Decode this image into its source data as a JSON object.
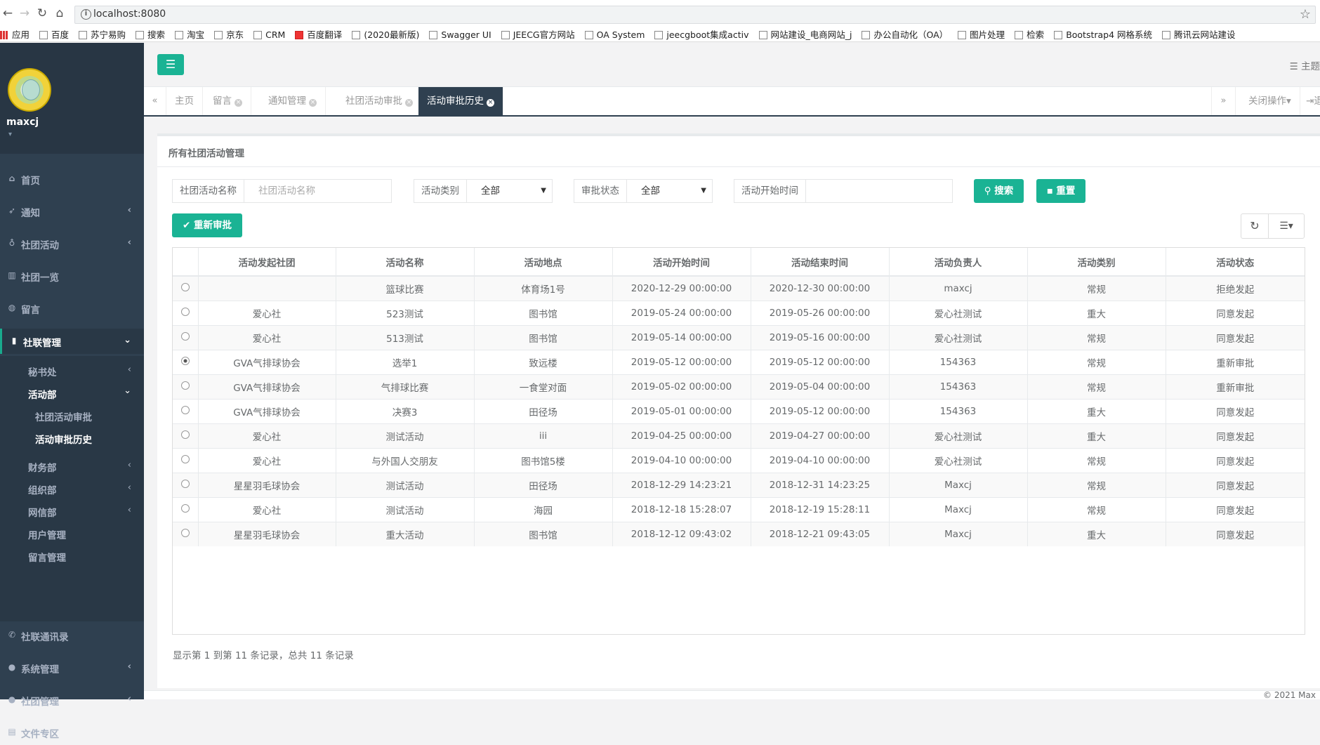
{
  "browser": {
    "url": "localhost:8080",
    "bookmarks": [
      "应用",
      "百度",
      "苏宁易购",
      "搜索",
      "淘宝",
      "京东",
      "CRM",
      "百度翻译",
      "(2020最新版)",
      "Swagger UI",
      "JEECG官方网站",
      "OA System",
      "jeecgboot集成activ",
      "网站建设_电商网站_j",
      "办公自动化（OA）",
      "图片处理",
      "检索",
      "Bootstrap4 网格系统",
      "腾讯云网站建设"
    ]
  },
  "sidebar": {
    "username": "maxcj",
    "menu": [
      {
        "label": "首页"
      },
      {
        "label": "通知"
      },
      {
        "label": "社团活动"
      },
      {
        "label": "社团一览"
      },
      {
        "label": "留言"
      },
      {
        "label": "社联管理"
      }
    ],
    "sub": [
      {
        "label": "秘书处"
      },
      {
        "label": "活动部"
      },
      {
        "label": "社团活动审批"
      },
      {
        "label": "活动审批历史"
      },
      {
        "label": "财务部"
      },
      {
        "label": "组织部"
      },
      {
        "label": "网信部"
      },
      {
        "label": "用户管理"
      },
      {
        "label": "留言管理"
      }
    ],
    "bottom": [
      {
        "label": "社联通讯录"
      },
      {
        "label": "系统管理"
      },
      {
        "label": "社团管理"
      },
      {
        "label": "文件专区"
      }
    ]
  },
  "header": {
    "theme_label": "主题"
  },
  "tabs": [
    "主页",
    "留言",
    "通知管理",
    "社团活动审批",
    "活动审批历史"
  ],
  "tab_tools": {
    "close_ops": "关闭操作",
    "logout": "退"
  },
  "panel": {
    "title": "所有社团活动管理",
    "filters": {
      "name_label": "社团活动名称",
      "name_placeholder": "社团活动名称",
      "type_label": "活动类别",
      "type_value": "全部",
      "status_label": "审批状态",
      "status_value": "全部",
      "start_label": "活动开始时间",
      "start_value": ""
    },
    "search_btn": "搜索",
    "reset_btn": "重置",
    "reapprove_btn": "重新审批",
    "columns": [
      "",
      "活动发起社团",
      "活动名称",
      "活动地点",
      "活动开始时间",
      "活动结束时间",
      "活动负责人",
      "活动类别",
      "活动状态"
    ],
    "rows": [
      {
        "club": "",
        "name": "篮球比赛",
        "place": "体育场1号",
        "start": "2020-12-29 00:00:00",
        "end": "2020-12-30 00:00:00",
        "owner": "maxcj",
        "type": "常规",
        "status": "拒绝发起",
        "selected": false
      },
      {
        "club": "爱心社",
        "name": "523测试",
        "place": "图书馆",
        "start": "2019-05-24 00:00:00",
        "end": "2019-05-26 00:00:00",
        "owner": "爱心社测试",
        "type": "重大",
        "status": "同意发起",
        "selected": false
      },
      {
        "club": "爱心社",
        "name": "513测试",
        "place": "图书馆",
        "start": "2019-05-14 00:00:00",
        "end": "2019-05-16 00:00:00",
        "owner": "爱心社测试",
        "type": "常规",
        "status": "同意发起",
        "selected": false
      },
      {
        "club": "GVA气排球协会",
        "name": "选举1",
        "place": "致远楼",
        "start": "2019-05-12 00:00:00",
        "end": "2019-05-12 00:00:00",
        "owner": "154363",
        "type": "常规",
        "status": "重新审批",
        "selected": true
      },
      {
        "club": "GVA气排球协会",
        "name": "气排球比赛",
        "place": "一食堂对面",
        "start": "2019-05-02 00:00:00",
        "end": "2019-05-04 00:00:00",
        "owner": "154363",
        "type": "常规",
        "status": "重新审批",
        "selected": false
      },
      {
        "club": "GVA气排球协会",
        "name": "决赛3",
        "place": "田径场",
        "start": "2019-05-01 00:00:00",
        "end": "2019-05-12 00:00:00",
        "owner": "154363",
        "type": "重大",
        "status": "同意发起",
        "selected": false
      },
      {
        "club": "爱心社",
        "name": "测试活动",
        "place": "iii",
        "start": "2019-04-25 00:00:00",
        "end": "2019-04-27 00:00:00",
        "owner": "爱心社测试",
        "type": "重大",
        "status": "同意发起",
        "selected": false
      },
      {
        "club": "爱心社",
        "name": "与外国人交朋友",
        "place": "图书馆5楼",
        "start": "2019-04-10 00:00:00",
        "end": "2019-04-10 00:00:00",
        "owner": "爱心社测试",
        "type": "常规",
        "status": "同意发起",
        "selected": false
      },
      {
        "club": "星星羽毛球协会",
        "name": "测试活动",
        "place": "田径场",
        "start": "2018-12-29 14:23:21",
        "end": "2018-12-31 14:23:25",
        "owner": "Maxcj",
        "type": "常规",
        "status": "同意发起",
        "selected": false
      },
      {
        "club": "爱心社",
        "name": "测试活动",
        "place": "海园",
        "start": "2018-12-18 15:28:07",
        "end": "2018-12-19 15:28:11",
        "owner": "Maxcj",
        "type": "常规",
        "status": "同意发起",
        "selected": false
      },
      {
        "club": "星星羽毛球协会",
        "name": "重大活动",
        "place": "图书馆",
        "start": "2018-12-12 09:43:02",
        "end": "2018-12-21 09:43:05",
        "owner": "Maxcj",
        "type": "重大",
        "status": "同意发起",
        "selected": false
      }
    ],
    "pager_text": "显示第 1 到第 11 条记录，总共 11 条记录"
  },
  "footer": {
    "text": "© 2021 Max"
  },
  "colors": {
    "accent": "#1ab394",
    "sidebar": "#2f4050"
  }
}
